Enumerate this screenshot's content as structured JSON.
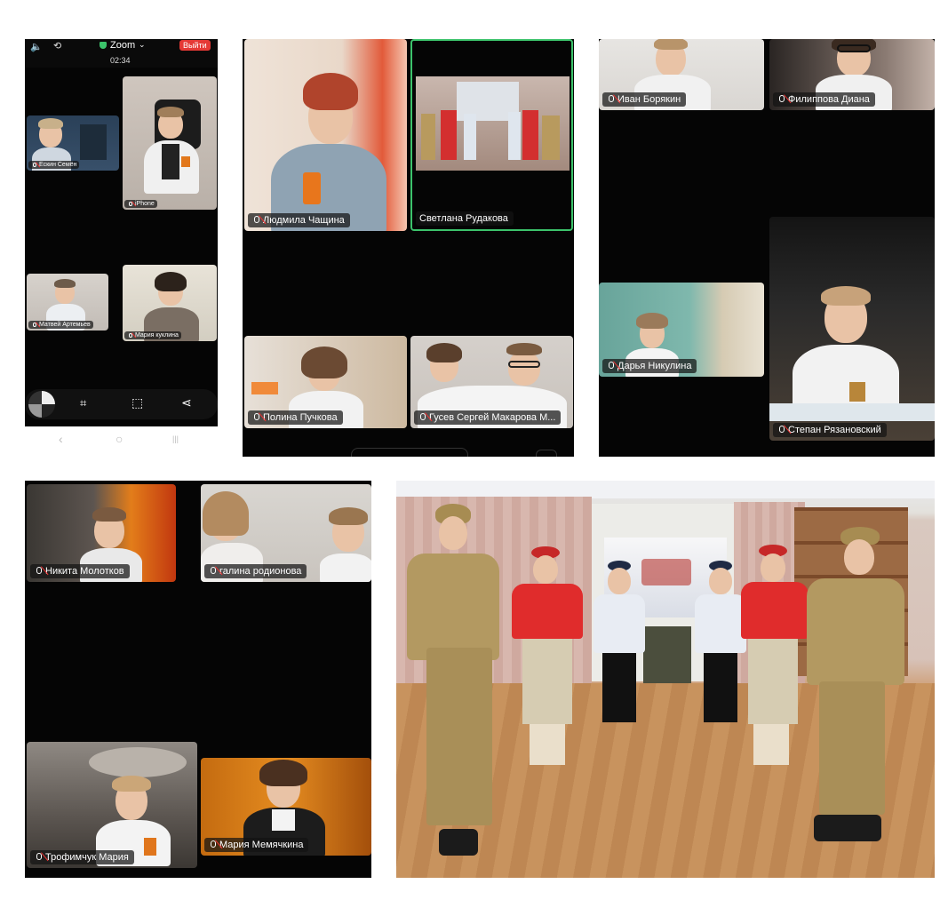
{
  "phone": {
    "status": {
      "app": "Zoom",
      "time": "02:34",
      "leave": "Выйти"
    },
    "participants": [
      {
        "name": "Ескин Семён"
      },
      {
        "name": "iPhone"
      },
      {
        "name": "Матвей Артемьев"
      },
      {
        "name": "Мария куклина"
      }
    ],
    "toolbar_icons": [
      "record-icon",
      "screenshot-icon",
      "crop-icon",
      "share-icon"
    ],
    "nav": {
      "back": "‹",
      "home": "○",
      "recent": "|||"
    }
  },
  "panel2": {
    "participants": [
      {
        "name": "Людмила Чащина"
      },
      {
        "name": "Светлана Рудакова"
      },
      {
        "name": "Полина Пучкова"
      },
      {
        "name": "Гусев Сергей Макарова М..."
      }
    ]
  },
  "panel3": {
    "participants": [
      {
        "name": "Иван Борякин"
      },
      {
        "name": "Филиппова Диана"
      },
      {
        "name": "Дарья Никулина"
      },
      {
        "name": "Степан Рязановский"
      }
    ]
  },
  "panel4": {
    "participants": [
      {
        "name": "Никита Молотков"
      },
      {
        "name": "галина родионова"
      },
      {
        "name": "Трофимчук Мария"
      },
      {
        "name": "Мария Мемячкина"
      }
    ]
  },
  "colors": {
    "active_speaker": "#3cc36b",
    "leave_button": "#e53935"
  }
}
